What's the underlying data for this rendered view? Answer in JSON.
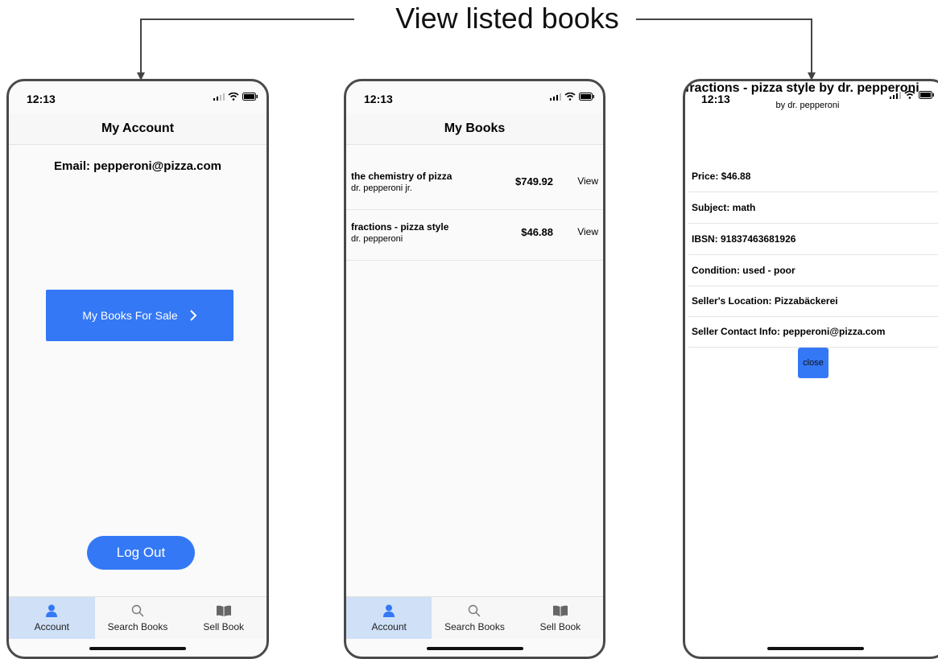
{
  "caption": "View listed books",
  "colors": {
    "accent": "#3478f6",
    "tab_active_bg": "#cfe0f7",
    "frame": "#4a4a4a"
  },
  "status": {
    "time": "12:13"
  },
  "tabs": [
    {
      "label": "Account",
      "icon": "person-icon"
    },
    {
      "label": "Search Books",
      "icon": "search-icon"
    },
    {
      "label": "Sell Book",
      "icon": "book-icon"
    }
  ],
  "account": {
    "title": "My Account",
    "email": "Email: pepperoni@pizza.com",
    "books_button": "My Books For Sale",
    "logout_button": "Log Out"
  },
  "my_books": {
    "title": "My Books",
    "books": [
      {
        "title": "the chemistry of pizza",
        "author": "dr. pepperoni jr.",
        "price": "$749.92",
        "action": "View"
      },
      {
        "title": "fractions - pizza style",
        "author": "dr. pepperoni",
        "price": "$46.88",
        "action": "View"
      }
    ]
  },
  "details": {
    "title": "fractions - pizza style by dr. pepperoni",
    "subtitle": "by dr. pepperoni",
    "fields": [
      "Price: $46.88",
      "Subject: math",
      "IBSN: 91837463681926",
      "Condition: used - poor",
      "Seller's Location: Pizzabäckerei",
      "Seller Contact Info: pepperoni@pizza.com"
    ],
    "close_button": "close"
  }
}
